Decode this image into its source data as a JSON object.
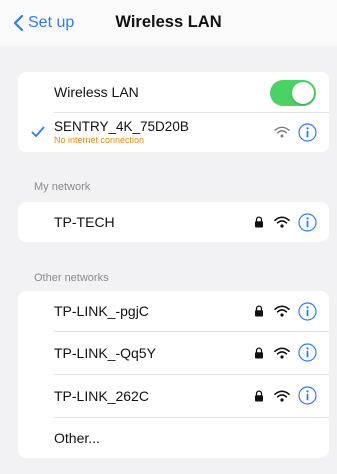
{
  "nav": {
    "back_label": "Set up",
    "title": "Wireless LAN"
  },
  "wlan": {
    "toggle_label": "Wireless LAN",
    "toggle_on": true,
    "connected": {
      "name": "SENTRY_4K_75D20B",
      "status": "No internet connection"
    }
  },
  "my_network": {
    "header": "My network",
    "items": [
      {
        "name": "TP-TECH"
      }
    ]
  },
  "other_networks": {
    "header": "Other networks",
    "items": [
      {
        "name": "TP-LINK_-pgjC"
      },
      {
        "name": "TP-LINK_-Qq5Y"
      },
      {
        "name": "TP-LINK_262C"
      }
    ],
    "other_label": "Other..."
  },
  "colors": {
    "accent": "#2f7bf5",
    "toggle_on": "#4cd264",
    "warning": "#e28a1b",
    "background": "#f2f2f4"
  },
  "icons": [
    "chevron-left-icon",
    "checkmark-icon",
    "lock-icon",
    "wifi-icon",
    "info-icon"
  ]
}
